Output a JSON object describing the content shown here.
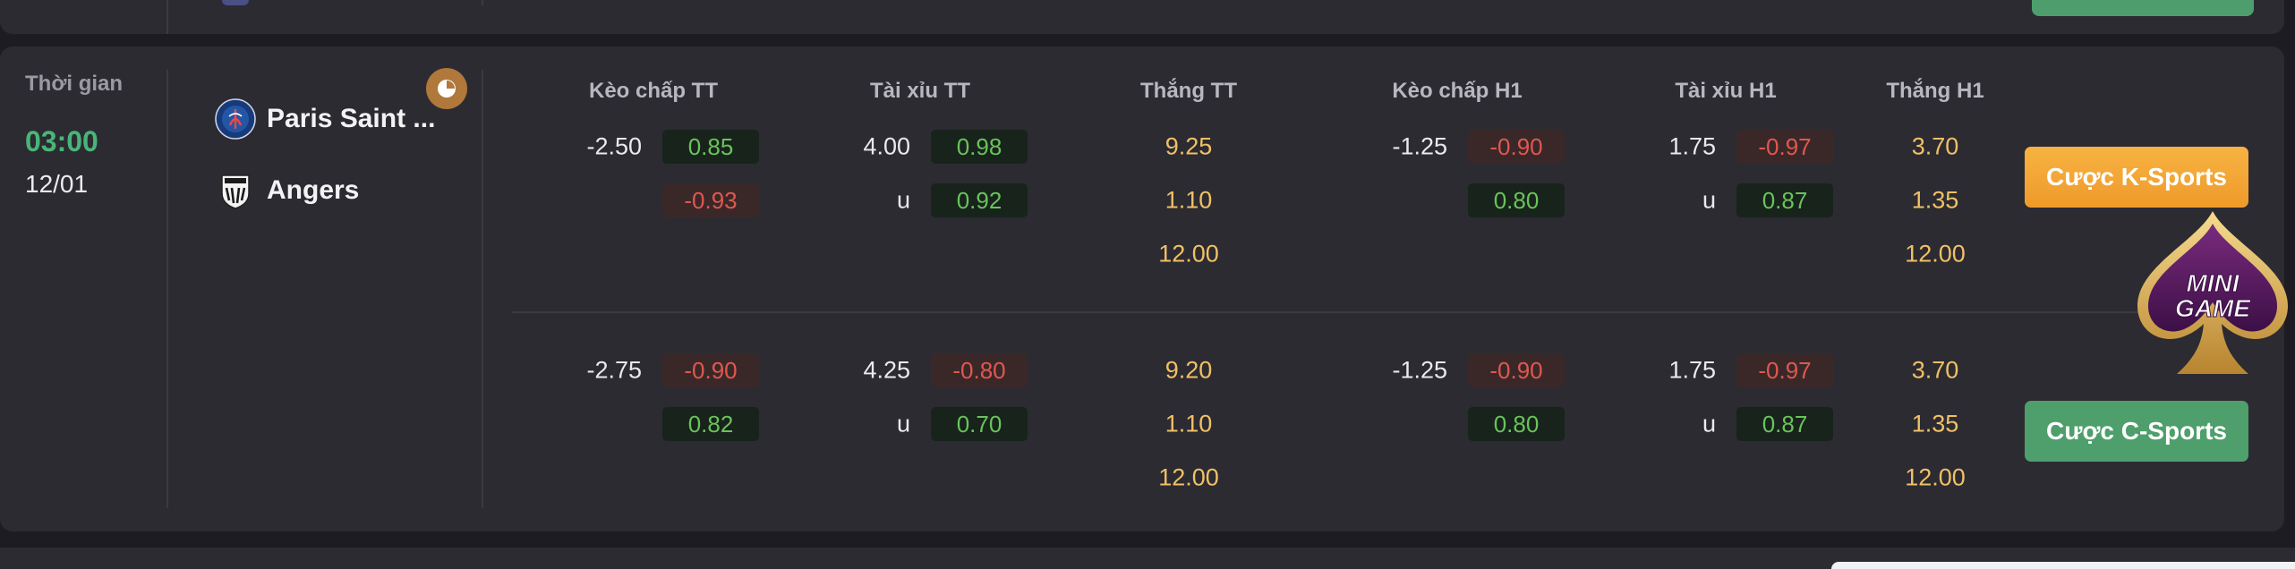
{
  "match": {
    "time_label": "Thời gian",
    "time": "03:00",
    "date": "12/01",
    "home_team": "Paris Saint ...",
    "away_team": "Angers",
    "home_crest_icon": "psg-crest-icon",
    "away_crest_icon": "angers-crest-icon",
    "stats_icon": "chart-icon"
  },
  "columns": [
    "Kèo chấp TT",
    "Tài xỉu TT",
    "Thắng TT",
    "Kèo chấp H1",
    "Tài xỉu H1",
    "Thắng H1"
  ],
  "markets": [
    {
      "name": "K-Sports",
      "button": "Cược K-Sports",
      "handicap_tt": {
        "line": "-2.50",
        "home": "0.85",
        "home_color": "green",
        "away": "-0.93",
        "away_color": "red"
      },
      "ou_tt": {
        "line": "4.00",
        "under_label": "u",
        "over": "0.98",
        "over_color": "green",
        "under": "0.92",
        "under_color": "green"
      },
      "win_tt": [
        "9.25",
        "1.10",
        "12.00"
      ],
      "handicap_h1": {
        "line": "-1.25",
        "home": "-0.90",
        "home_color": "red",
        "away": "0.80",
        "away_color": "green"
      },
      "ou_h1": {
        "line": "1.75",
        "under_label": "u",
        "over": "-0.97",
        "over_color": "red",
        "under": "0.87",
        "under_color": "green"
      },
      "win_h1": [
        "3.70",
        "1.35",
        "12.00"
      ]
    },
    {
      "name": "C-Sports",
      "button": "Cược C-Sports",
      "handicap_tt": {
        "line": "-2.75",
        "home": "-0.90",
        "home_color": "red",
        "away": "0.82",
        "away_color": "green"
      },
      "ou_tt": {
        "line": "4.25",
        "under_label": "u",
        "over": "-0.80",
        "over_color": "red",
        "under": "0.70",
        "under_color": "green"
      },
      "win_tt": [
        "9.20",
        "1.10",
        "12.00"
      ],
      "handicap_h1": {
        "line": "-1.25",
        "home": "-0.90",
        "home_color": "red",
        "away": "0.80",
        "away_color": "green"
      },
      "ou_h1": {
        "line": "1.75",
        "under_label": "u",
        "over": "-0.97",
        "over_color": "red",
        "under": "0.87",
        "under_color": "green"
      },
      "win_h1": [
        "3.70",
        "1.35",
        "12.00"
      ]
    }
  ],
  "minigame": {
    "line1": "MINI",
    "line2": "GAME",
    "icon": "minigame-spade-icon"
  },
  "colors": {
    "positive": "#69c35a",
    "negative": "#e0574f",
    "win_odds": "#f0c067",
    "time": "#48b579",
    "kbutton": "#f5a93a",
    "cbutton": "#4e9f6c"
  }
}
